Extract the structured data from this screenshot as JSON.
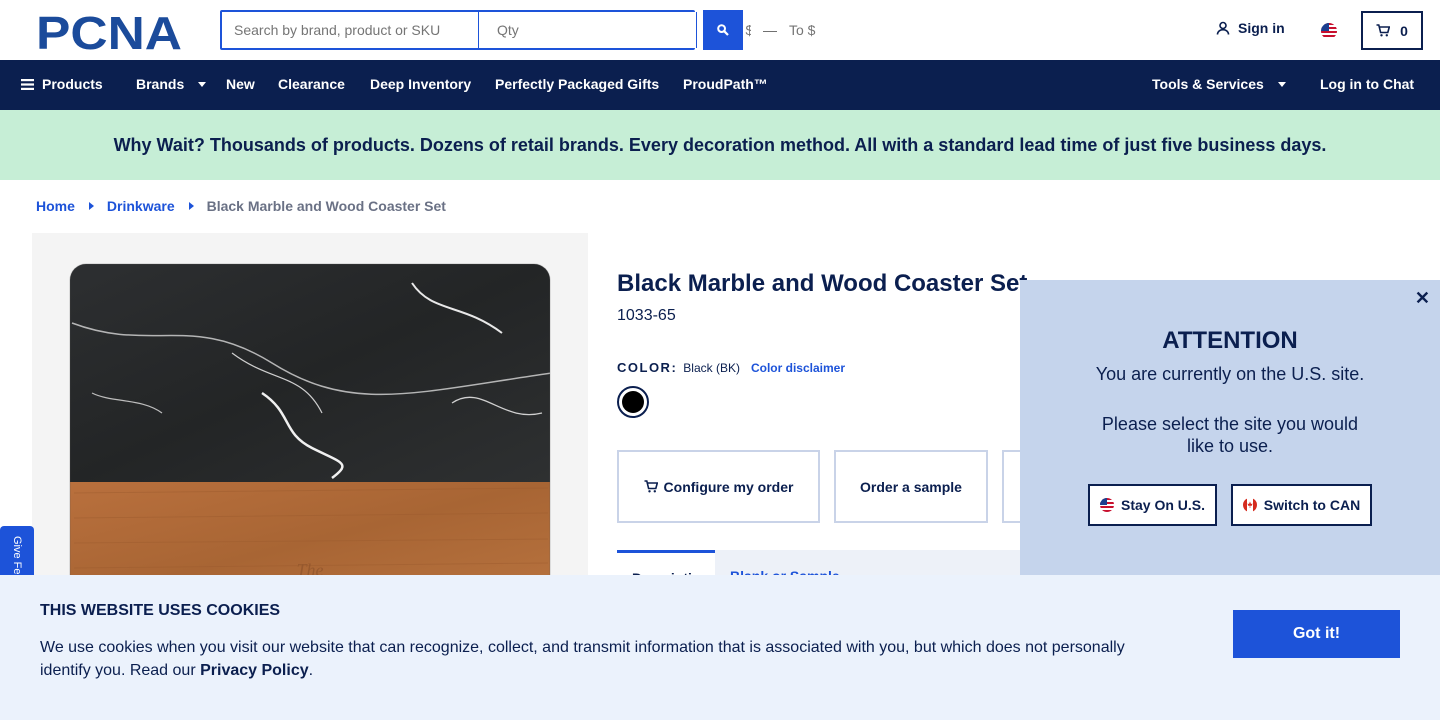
{
  "header": {
    "logo_text": "PCNA",
    "search_placeholder": "Search by brand, product or SKU",
    "qty_placeholder": "Qty",
    "from_placeholder": "From $",
    "range_dash": "—",
    "to_placeholder": "To $",
    "signin_label": "Sign in",
    "cart_count": "0"
  },
  "nav": {
    "products": "Products",
    "brands": "Brands",
    "new": "New",
    "clearance": "Clearance",
    "deep_inventory": "Deep Inventory",
    "gifts": "Perfectly Packaged Gifts",
    "proudpath": "ProudPath™",
    "tools": "Tools & Services",
    "chat": "Log in to Chat"
  },
  "promo": "Why Wait? Thousands of products. Dozens of retail brands. Every decoration method. All with a standard lead time of just five business days.",
  "breadcrumb": {
    "home": "Home",
    "category": "Drinkware",
    "current": "Black Marble and Wood Coaster Set"
  },
  "product": {
    "title": "Black Marble and Wood Coaster Set",
    "sku": "1033-65",
    "color_label": "COLOR:",
    "color_value": "Black (BK)",
    "color_disclaimer": "Color disclaimer",
    "swatch_color": "#000000",
    "configure_label": "Configure my order",
    "sample_label": "Order a sample",
    "tab_1": "Description",
    "tab_2": "Blank or Sample"
  },
  "feedback_label": "Give Feedback",
  "modal": {
    "title": "ATTENTION",
    "line1": "You are currently on the U.S. site.",
    "line2": "Please select the site you would like to use.",
    "stay_label": "Stay On U.S.",
    "switch_label": "Switch to CAN",
    "close_glyph": "✕"
  },
  "cookies": {
    "title": "THIS WEBSITE USES COOKIES",
    "text": "We use cookies when you visit our website that can recognize, collect, and transmit information that is associated with you, but which does not personally identify you. Read our ",
    "link": "Privacy Policy",
    "end": ".",
    "button": "Got it!"
  },
  "colors": {
    "navy": "#0b1f4f",
    "blue": "#1d53d9",
    "promo_bg": "#c6eed6",
    "modal_bg": "#c5d4ec",
    "cookie_bg": "#ebf2fc"
  }
}
